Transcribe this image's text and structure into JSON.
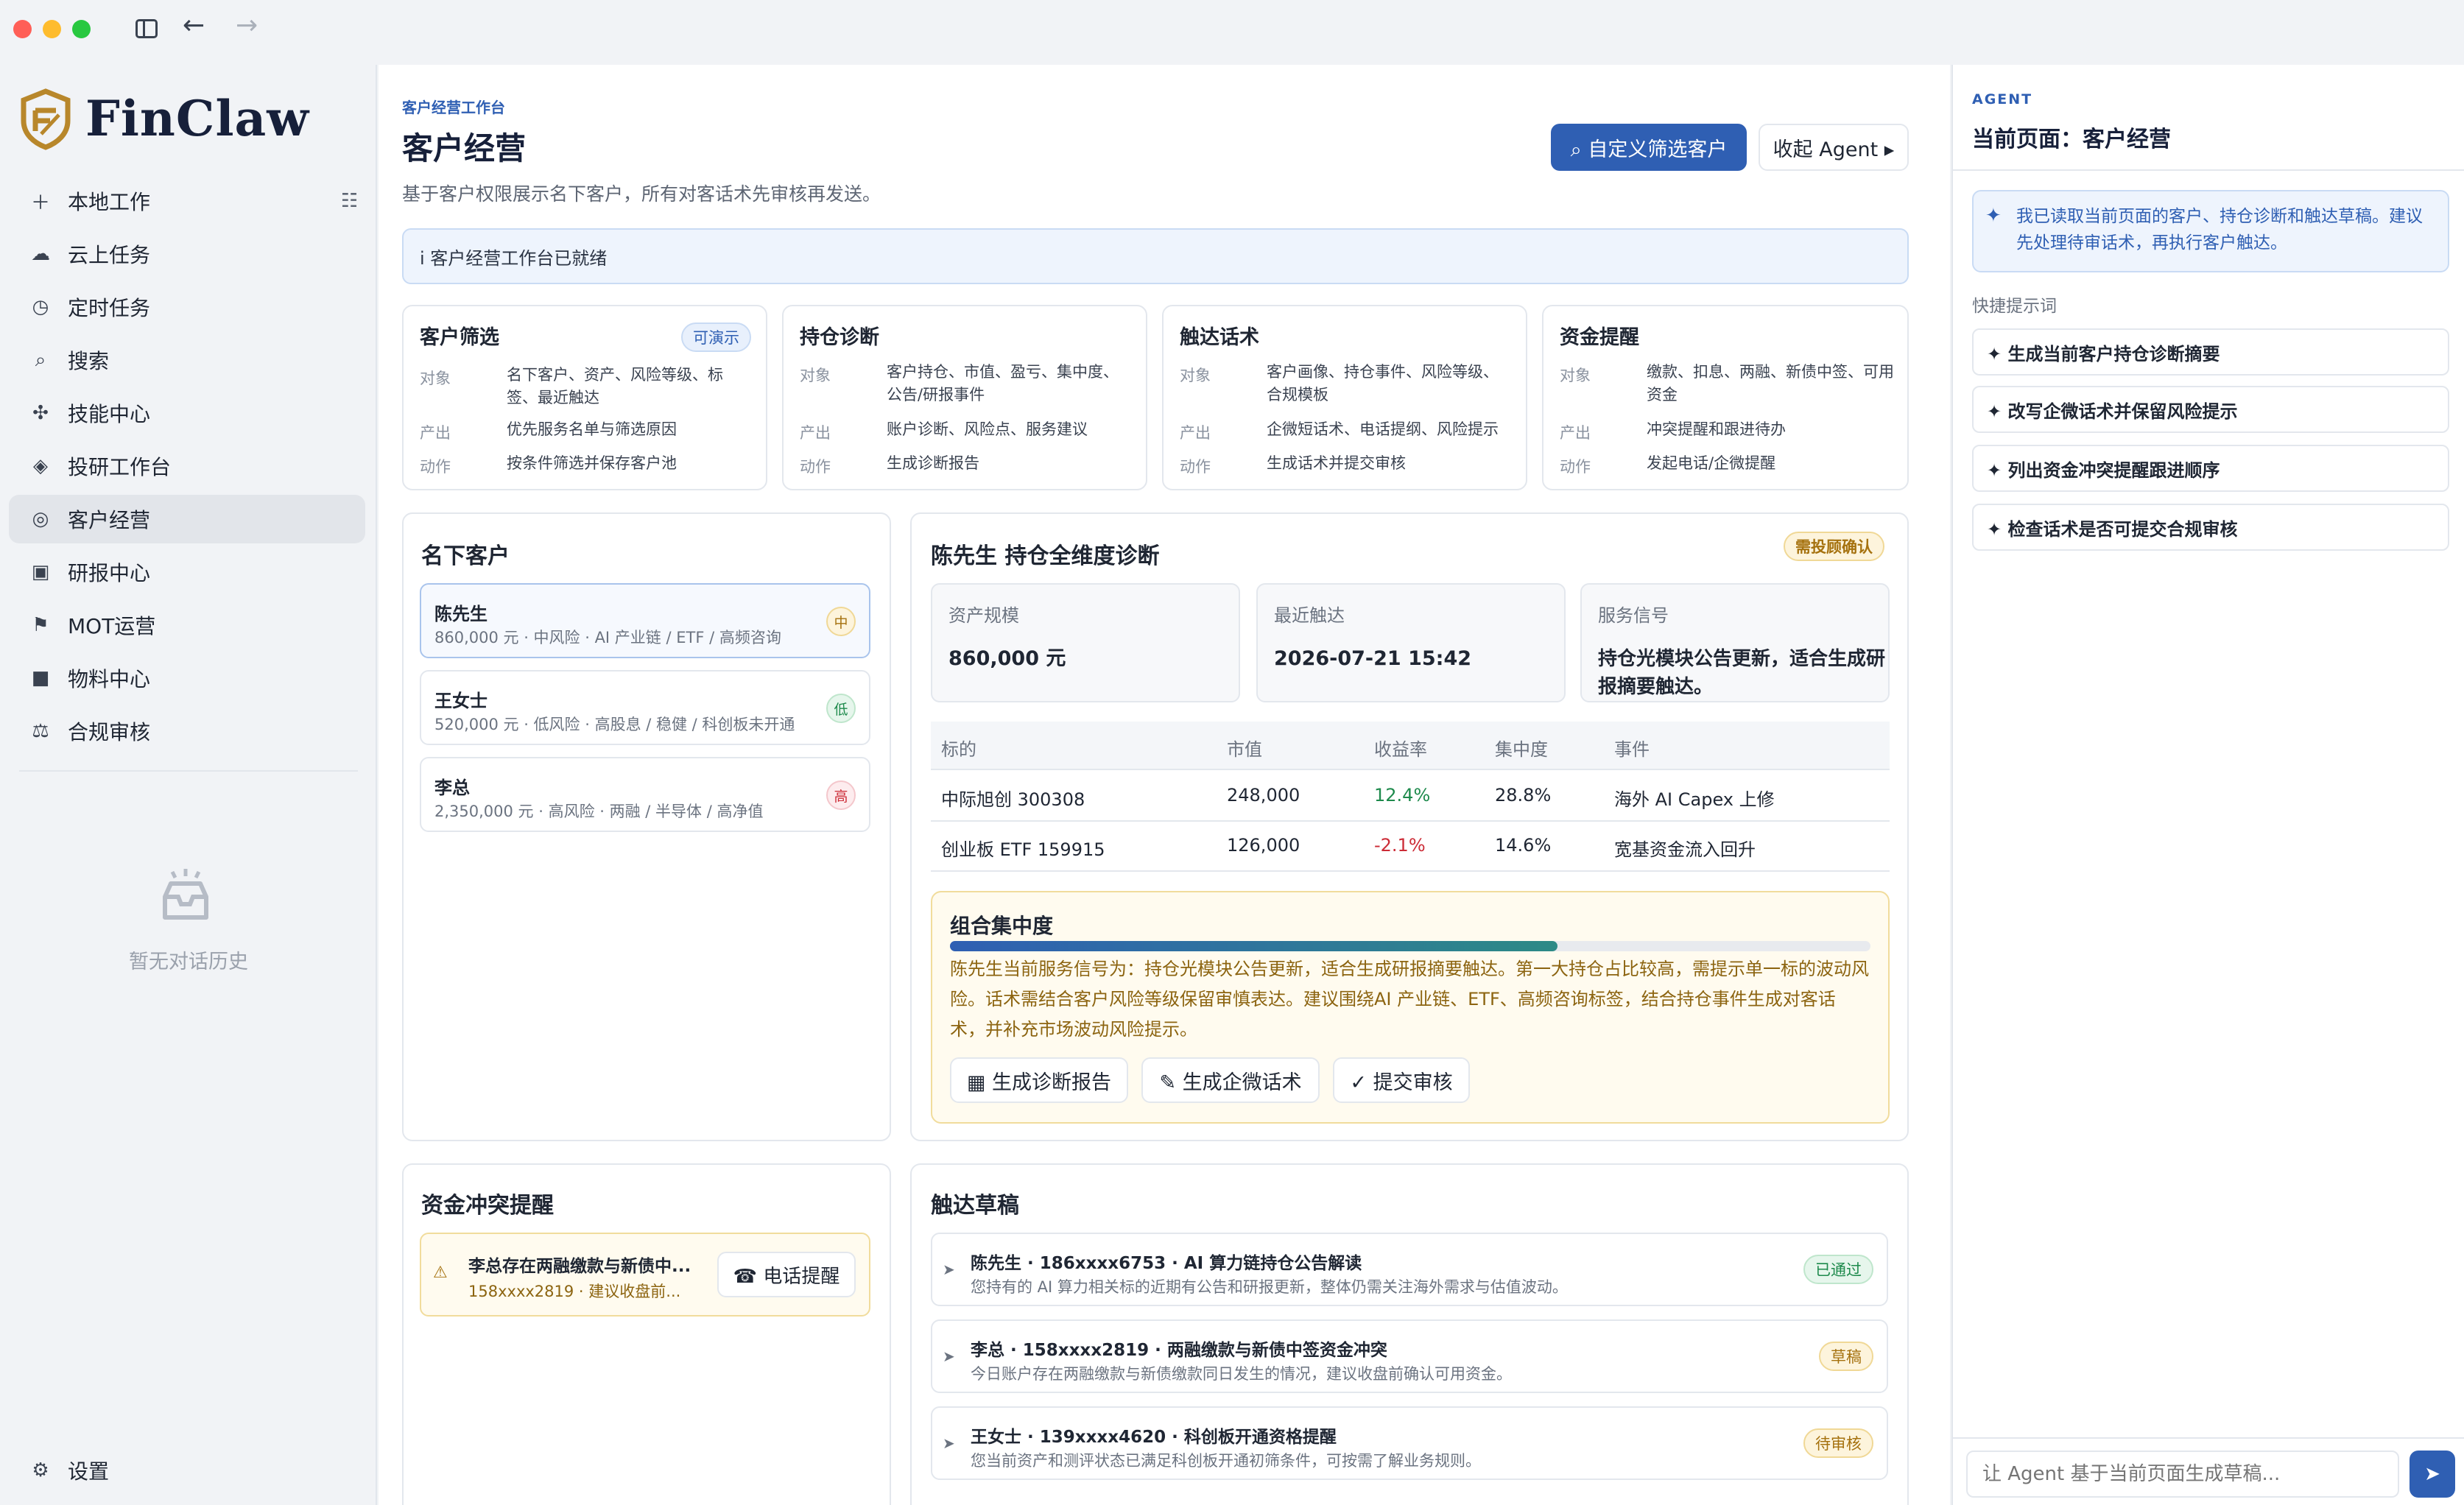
{
  "sidebar": {
    "logo": "FinClaw",
    "nav": [
      {
        "label": "本地工作",
        "icon": "plus-icon"
      },
      {
        "label": "云上任务",
        "icon": "cloud-icon"
      },
      {
        "label": "定时任务",
        "icon": "clock-icon"
      },
      {
        "label": "搜索",
        "icon": "search-icon"
      },
      {
        "label": "技能中心",
        "icon": "puzzle-icon"
      },
      {
        "label": "投研工作台",
        "icon": "diamond-icon"
      },
      {
        "label": "客户经营",
        "icon": "target-icon",
        "active": true
      },
      {
        "label": "研报中心",
        "icon": "square-icon"
      },
      {
        "label": "MOT运营",
        "icon": "flag-icon"
      },
      {
        "label": "物料中心",
        "icon": "box-icon"
      },
      {
        "label": "合规审核",
        "icon": "scale-icon"
      }
    ],
    "empty_history": "暂无对话历史",
    "settings": "设置"
  },
  "header": {
    "breadcrumb": "客户经营工作台",
    "title": "客户经营",
    "subtitle": "基于客户权限展示名下客户，所有对客话术先审核再发送。",
    "filter_button": "⌕ 自定义筛选客户",
    "collapse_button": "收起 Agent ▸",
    "status": "i  客户经营工作台已就绪"
  },
  "capabilities": [
    {
      "title": "客户筛选",
      "badge": "可演示",
      "rows": [
        [
          "对象",
          "名下客户、资产、风险等级、标签、最近触达"
        ],
        [
          "产出",
          "优先服务名单与筛选原因"
        ],
        [
          "动作",
          "按条件筛选并保存客户池"
        ]
      ]
    },
    {
      "title": "持仓诊断",
      "badge": "",
      "rows": [
        [
          "对象",
          "客户持仓、市值、盈亏、集中度、公告/研报事件"
        ],
        [
          "产出",
          "账户诊断、风险点、服务建议"
        ],
        [
          "动作",
          "生成诊断报告"
        ]
      ]
    },
    {
      "title": "触达话术",
      "badge": "",
      "rows": [
        [
          "对象",
          "客户画像、持仓事件、风险等级、合规模板"
        ],
        [
          "产出",
          "企微短话术、电话提纲、风险提示"
        ],
        [
          "动作",
          "生成话术并提交审核"
        ]
      ]
    },
    {
      "title": "资金提醒",
      "badge": "",
      "rows": [
        [
          "对象",
          "缴款、扣息、两融、新债中签、可用资金"
        ],
        [
          "产出",
          "冲突提醒和跟进待办"
        ],
        [
          "动作",
          "发起电话/企微提醒"
        ]
      ]
    }
  ],
  "clients": {
    "title": "名下客户",
    "items": [
      {
        "name": "陈先生",
        "desc": "860,000 元 · 中风险 · AI 产业链 / ETF / 高频咨询",
        "level": "中"
      },
      {
        "name": "王女士",
        "desc": "520,000 元 · 低风险 · 高股息 / 稳健 / 科创板未开通",
        "level": "低"
      },
      {
        "name": "李总",
        "desc": "2,350,000 元 · 高风险 · 两融 / 半导体 / 高净值",
        "level": "高"
      }
    ]
  },
  "diagnosis": {
    "title": "陈先生 持仓全维度诊断",
    "badge": "需投顾确认",
    "stats": [
      {
        "label": "资产规模",
        "value": "860,000 元"
      },
      {
        "label": "最近触达",
        "value": "2026-07-21 15:42"
      },
      {
        "label": "服务信号",
        "value": "持仓光模块公告更新，适合生成研报摘要触达。"
      }
    ],
    "columns": [
      "标的",
      "市值",
      "收益率",
      "集中度",
      "事件"
    ],
    "rows": [
      {
        "name": "中际旭创 300308",
        "value": "248,000",
        "ret": "12.4%",
        "conc": "28.8%",
        "event": "海外 AI Capex 上修"
      },
      {
        "name": "创业板 ETF 159915",
        "value": "126,000",
        "ret": "-2.1%",
        "conc": "14.6%",
        "event": "宽基资金流入回升"
      }
    ],
    "concentration": {
      "title": "组合集中度",
      "level": 0.66,
      "text": "陈先生当前服务信号为：持仓光模块公告更新，适合生成研报摘要触达。第一大持仓占比较高，需提示单一标的波动风险。话术需结合客户风险等级保留审慎表达。建议围绕AI 产业链、ETF、高频咨询标签，结合持仓事件生成对客话术，并补充市场波动风险提示。",
      "buttons": [
        "▦ 生成诊断报告",
        "✎ 生成企微话术",
        "✓ 提交审核"
      ]
    }
  },
  "funds": {
    "title": "资金冲突提醒",
    "item_title": "李总存在两融缴款与新债中...",
    "item_desc": "158xxxx2819 · 建议收盘前...",
    "call_button": "☎ 电话提醒"
  },
  "drafts": {
    "title": "触达草稿",
    "items": [
      {
        "title": "陈先生 · 186xxxx6753 · AI 算力链持仓公告解读",
        "desc": "您持有的 AI 算力相关标的近期有公告和研报更新，整体仍需关注海外需求与估值波动。",
        "status": "已通过",
        "status_color": "#1e8a4c"
      },
      {
        "title": "李总 · 158xxxx2819 · 两融缴款与新债中签资金冲突",
        "desc": "今日账户存在两融缴款与新债缴款同日发生的情况，建议收盘前确认可用资金。",
        "status": "草稿",
        "status_color": "#a5710e"
      },
      {
        "title": "王女士 · 139xxxx4620 · 科创板开通资格提醒",
        "desc": "您当前资产和测评状态已满足科创板开通初筛条件，可按需了解业务规则。",
        "status": "待审核",
        "status_color": "#a5710e"
      }
    ]
  },
  "agent": {
    "label": "AGENT",
    "title": "当前页面：客户经营",
    "message": "我已读取当前页面的客户、持仓诊断和触达草稿。建议先处理待审话术，再执行客户触达。",
    "quick_label": "快捷提示词",
    "prompts": [
      "✦ 生成当前客户持仓诊断摘要",
      "✦ 改写企微话术并保留风险提示",
      "✦ 列出资金冲突提醒跟进顺序",
      "✦ 检查话术是否可提交合规审核"
    ],
    "input_placeholder": "让 Agent 基于当前页面生成草稿...",
    "send_icon": "send-icon"
  },
  "colors": {
    "accent": "#2f5fb3",
    "gold": "#b8872b",
    "positive": "#1e8a4c",
    "negative": "#cc2b36"
  }
}
